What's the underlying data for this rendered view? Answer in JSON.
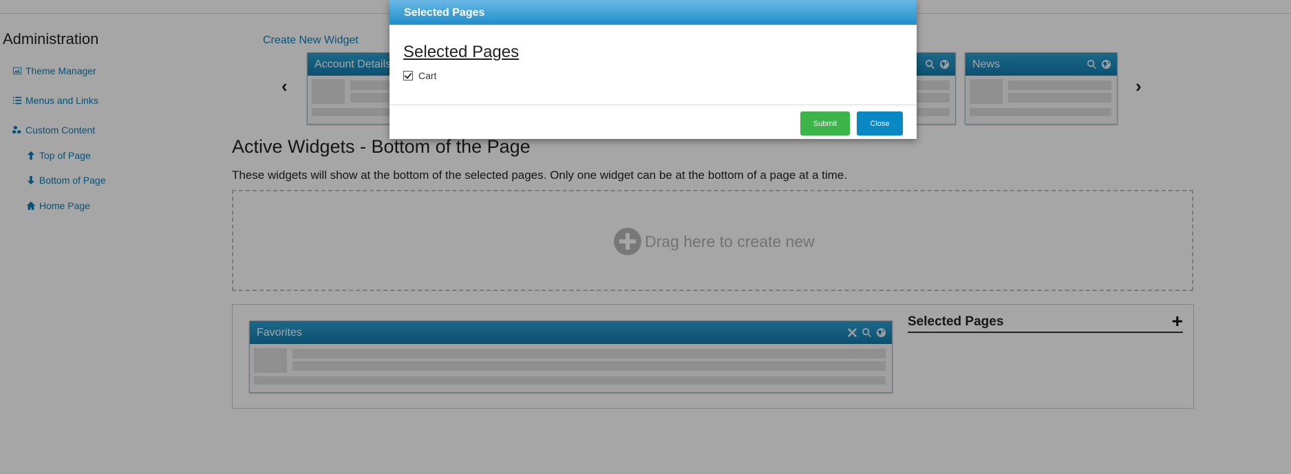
{
  "sidebar": {
    "title": "Administration",
    "items": [
      {
        "label": "Theme Manager",
        "icon": "image-icon"
      },
      {
        "label": "Menus and Links",
        "icon": "list-icon"
      },
      {
        "label": "Custom Content",
        "icon": "cubes-icon"
      },
      {
        "label": "Top of Page",
        "icon": "arrow-up-icon"
      },
      {
        "label": "Bottom of Page",
        "icon": "arrow-down-icon"
      },
      {
        "label": "Home Page",
        "icon": "home-icon"
      }
    ]
  },
  "widgets_library": {
    "create_link": "Create New Widget",
    "prev_arrow": "‹",
    "next_arrow": "›",
    "cards": [
      {
        "title": "Account Details"
      },
      {
        "title": "News"
      }
    ]
  },
  "active_section": {
    "title": "Active Widgets - Bottom of the Page",
    "description": "These widgets will show at the bottom of the selected pages. Only one widget can be at the bottom of a page at a time.",
    "dropzone_text": "Drag here to create new",
    "widget": {
      "title": "Favorites"
    },
    "selected_pages_heading": "Selected Pages",
    "add_symbol": "+"
  },
  "modal": {
    "header": "Selected Pages",
    "title": "Selected Pages",
    "pages": [
      {
        "label": "Cart",
        "checked": true
      }
    ],
    "submit_label": "Submit",
    "close_label": "Close"
  },
  "colors": {
    "accent": "#147cb0",
    "link": "#0a7fb5",
    "submit": "#3cb44a",
    "close": "#0a88c3"
  }
}
